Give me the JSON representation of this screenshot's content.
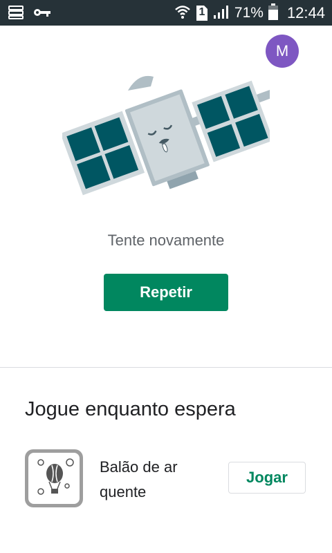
{
  "status_bar": {
    "battery": "71%",
    "time": "12:44",
    "sim_slot": "1",
    "icons": [
      "storage-icon",
      "key-icon",
      "wifi-icon",
      "sim-icon",
      "signal-icon",
      "battery-icon"
    ]
  },
  "account": {
    "avatar_letter": "M",
    "avatar_color": "#7e57c2"
  },
  "error": {
    "illustration": "sleeping-satellite",
    "message": "Tente novamente",
    "retry_label": "Repetir",
    "accent_color": "#01875f"
  },
  "games_section": {
    "title": "Jogue enquanto espera",
    "games": [
      {
        "name_line1": "Balão de ar",
        "name_line2": "quente",
        "play_label": "Jogar",
        "icon": "hot-air-balloon-icon"
      }
    ]
  }
}
